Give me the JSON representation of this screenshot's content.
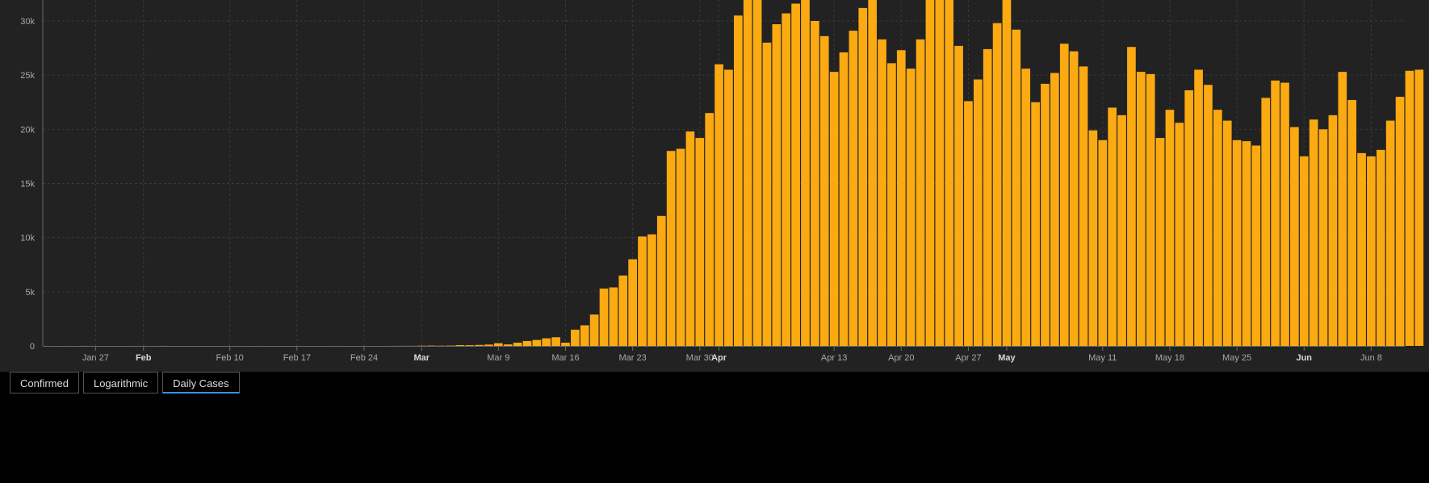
{
  "tabs": [
    {
      "label": "Confirmed",
      "active": false
    },
    {
      "label": "Logarithmic",
      "active": false
    },
    {
      "label": "Daily Cases",
      "active": true
    }
  ],
  "chart_data": {
    "type": "bar",
    "title": "",
    "xlabel": "",
    "ylabel": "",
    "ylim": [
      0,
      30000
    ],
    "bar_color": "#fcaa12",
    "y_ticks": [
      {
        "value": 0,
        "label": "0"
      },
      {
        "value": 5000,
        "label": "5k"
      },
      {
        "value": 10000,
        "label": "10k"
      },
      {
        "value": 15000,
        "label": "15k"
      },
      {
        "value": 20000,
        "label": "20k"
      },
      {
        "value": 25000,
        "label": "25k"
      },
      {
        "value": 30000,
        "label": "30k"
      }
    ],
    "x_ticks": [
      {
        "date": "2020-01-27",
        "label": "Jan 27",
        "bold": false
      },
      {
        "date": "2020-02-01",
        "label": "Feb",
        "bold": true
      },
      {
        "date": "2020-02-10",
        "label": "Feb 10",
        "bold": false
      },
      {
        "date": "2020-02-17",
        "label": "Feb 17",
        "bold": false
      },
      {
        "date": "2020-02-24",
        "label": "Feb 24",
        "bold": false
      },
      {
        "date": "2020-03-01",
        "label": "Mar",
        "bold": true
      },
      {
        "date": "2020-03-09",
        "label": "Mar 9",
        "bold": false
      },
      {
        "date": "2020-03-16",
        "label": "Mar 16",
        "bold": false
      },
      {
        "date": "2020-03-23",
        "label": "Mar 23",
        "bold": false
      },
      {
        "date": "2020-03-30",
        "label": "Mar 30",
        "bold": false
      },
      {
        "date": "2020-04-01",
        "label": "Apr",
        "bold": true
      },
      {
        "date": "2020-04-13",
        "label": "Apr 13",
        "bold": false
      },
      {
        "date": "2020-04-20",
        "label": "Apr 20",
        "bold": false
      },
      {
        "date": "2020-04-27",
        "label": "Apr 27",
        "bold": false
      },
      {
        "date": "2020-05-01",
        "label": "May",
        "bold": true
      },
      {
        "date": "2020-05-11",
        "label": "May 11",
        "bold": false
      },
      {
        "date": "2020-05-18",
        "label": "May 18",
        "bold": false
      },
      {
        "date": "2020-05-25",
        "label": "May 25",
        "bold": false
      },
      {
        "date": "2020-06-01",
        "label": "Jun",
        "bold": true
      },
      {
        "date": "2020-06-08",
        "label": "Jun 8",
        "bold": false
      }
    ],
    "x": [
      "2020-01-22",
      "2020-01-23",
      "2020-01-24",
      "2020-01-25",
      "2020-01-26",
      "2020-01-27",
      "2020-01-28",
      "2020-01-29",
      "2020-01-30",
      "2020-01-31",
      "2020-02-01",
      "2020-02-02",
      "2020-02-03",
      "2020-02-04",
      "2020-02-05",
      "2020-02-06",
      "2020-02-07",
      "2020-02-08",
      "2020-02-09",
      "2020-02-10",
      "2020-02-11",
      "2020-02-12",
      "2020-02-13",
      "2020-02-14",
      "2020-02-15",
      "2020-02-16",
      "2020-02-17",
      "2020-02-18",
      "2020-02-19",
      "2020-02-20",
      "2020-02-21",
      "2020-02-22",
      "2020-02-23",
      "2020-02-24",
      "2020-02-25",
      "2020-02-26",
      "2020-02-27",
      "2020-02-28",
      "2020-02-29",
      "2020-03-01",
      "2020-03-02",
      "2020-03-03",
      "2020-03-04",
      "2020-03-05",
      "2020-03-06",
      "2020-03-07",
      "2020-03-08",
      "2020-03-09",
      "2020-03-10",
      "2020-03-11",
      "2020-03-12",
      "2020-03-13",
      "2020-03-14",
      "2020-03-15",
      "2020-03-16",
      "2020-03-17",
      "2020-03-18",
      "2020-03-19",
      "2020-03-20",
      "2020-03-21",
      "2020-03-22",
      "2020-03-23",
      "2020-03-24",
      "2020-03-25",
      "2020-03-26",
      "2020-03-27",
      "2020-03-28",
      "2020-03-29",
      "2020-03-30",
      "2020-03-31",
      "2020-04-01",
      "2020-04-02",
      "2020-04-03",
      "2020-04-04",
      "2020-04-05",
      "2020-04-06",
      "2020-04-07",
      "2020-04-08",
      "2020-04-09",
      "2020-04-10",
      "2020-04-11",
      "2020-04-12",
      "2020-04-13",
      "2020-04-14",
      "2020-04-15",
      "2020-04-16",
      "2020-04-17",
      "2020-04-18",
      "2020-04-19",
      "2020-04-20",
      "2020-04-21",
      "2020-04-22",
      "2020-04-23",
      "2020-04-24",
      "2020-04-25",
      "2020-04-26",
      "2020-04-27",
      "2020-04-28",
      "2020-04-29",
      "2020-04-30",
      "2020-05-01",
      "2020-05-02",
      "2020-05-03",
      "2020-05-04",
      "2020-05-05",
      "2020-05-06",
      "2020-05-07",
      "2020-05-08",
      "2020-05-09",
      "2020-05-10",
      "2020-05-11",
      "2020-05-12",
      "2020-05-13",
      "2020-05-14",
      "2020-05-15",
      "2020-05-16",
      "2020-05-17",
      "2020-05-18",
      "2020-05-19",
      "2020-05-20",
      "2020-05-21",
      "2020-05-22",
      "2020-05-23",
      "2020-05-24",
      "2020-05-25",
      "2020-05-26",
      "2020-05-27",
      "2020-05-28",
      "2020-05-29",
      "2020-05-30",
      "2020-05-31",
      "2020-06-01",
      "2020-06-02",
      "2020-06-03",
      "2020-06-04",
      "2020-06-05",
      "2020-06-06",
      "2020-06-07",
      "2020-06-08",
      "2020-06-09",
      "2020-06-10",
      "2020-06-11"
    ],
    "series": [
      {
        "values": [
          1,
          0,
          1,
          0,
          3,
          0,
          0,
          0,
          0,
          2,
          1,
          0,
          3,
          0,
          0,
          0,
          0,
          0,
          0,
          0,
          1,
          0,
          1,
          0,
          0,
          0,
          0,
          0,
          0,
          0,
          2,
          0,
          0,
          0,
          0,
          0,
          3,
          7,
          8,
          22,
          31,
          20,
          31,
          74,
          66,
          90,
          125,
          250,
          140,
          300,
          450,
          550,
          700,
          800,
          300,
          1500,
          1900,
          2900,
          5300,
          5400,
          6500,
          8000,
          10100,
          10300,
          12000,
          18000,
          18200,
          19800,
          19200,
          21500,
          26000,
          25500,
          30500,
          32500,
          32500,
          28000,
          29700,
          30700,
          31600,
          32500,
          30000,
          28600,
          25300,
          27100,
          29100,
          31200,
          33000,
          28300,
          26100,
          27300,
          25600,
          28300,
          33000,
          32000,
          33000,
          27700,
          22600,
          24600,
          27400,
          29800,
          32500,
          29200,
          25600,
          22500,
          24200,
          25200,
          27900,
          27200,
          25800,
          19900,
          19000,
          22000,
          21300,
          27600,
          25300,
          25100,
          19200,
          21800,
          20600,
          23600,
          25500,
          24100,
          21800,
          20800,
          19000,
          18900,
          18500,
          22900,
          24500,
          24300,
          20200,
          17500,
          20900,
          20000,
          21300,
          25300,
          22700,
          17800,
          17500,
          18100,
          20800,
          23000,
          25400,
          25500
        ]
      }
    ]
  }
}
